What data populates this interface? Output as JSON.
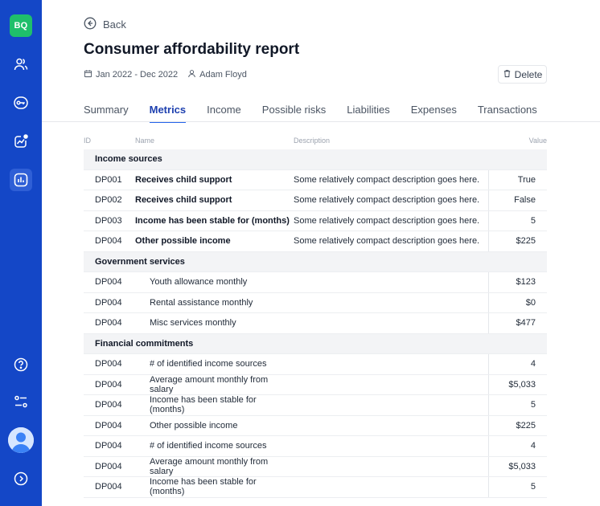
{
  "sidebar": {
    "logo": "BQ",
    "nav_icons": [
      "users-icon",
      "key-icon",
      "trend-icon",
      "chart-icon"
    ],
    "bottom_icons": [
      "help-icon",
      "settings-icon"
    ],
    "accent": "#1447c7",
    "logo_color": "#1fbf6b"
  },
  "header": {
    "back_label": "Back",
    "title": "Consumer affordability report",
    "date_range": "Jan 2022 - Dec 2022",
    "user": "Adam Floyd",
    "delete_label": "Delete"
  },
  "tabs": [
    {
      "label": "Summary",
      "active": false
    },
    {
      "label": "Metrics",
      "active": true
    },
    {
      "label": "Income",
      "active": false
    },
    {
      "label": "Possible risks",
      "active": false
    },
    {
      "label": "Liabilities",
      "active": false
    },
    {
      "label": "Expenses",
      "active": false
    },
    {
      "label": "Transactions",
      "active": false
    }
  ],
  "table": {
    "columns": {
      "id": "ID",
      "name": "Name",
      "description": "Description",
      "value": "Value"
    },
    "groups": [
      {
        "title": "Income sources",
        "rows": [
          {
            "id": "DP001",
            "name": "Receives child support",
            "description": "Some relatively compact description goes here.",
            "value": "True"
          },
          {
            "id": "DP002",
            "name": "Receives child support",
            "description": "Some relatively compact description goes here.",
            "value": "False"
          },
          {
            "id": "DP003",
            "name": "Income has been stable for (months)",
            "description": "Some relatively compact description goes here.",
            "value": "5"
          },
          {
            "id": "DP004",
            "name": "Other possible income",
            "description": "Some relatively compact description goes here.",
            "value": "$225"
          }
        ]
      },
      {
        "title": "Government services",
        "rows": [
          {
            "id": "DP004",
            "name": "Youth allowance monthly",
            "description": "",
            "value": "$123"
          },
          {
            "id": "DP004",
            "name": "Rental assistance monthly",
            "description": "",
            "value": "$0"
          },
          {
            "id": "DP004",
            "name": "Misc services monthly",
            "description": "",
            "value": "$477"
          }
        ]
      },
      {
        "title": "Financial commitments",
        "rows": [
          {
            "id": "DP004",
            "name": "# of identified income sources",
            "description": "",
            "value": "4"
          },
          {
            "id": "DP004",
            "name": "Average amount monthly from salary",
            "description": "",
            "value": "$5,033"
          },
          {
            "id": "DP004",
            "name": "Income has been stable for (months)",
            "description": "",
            "value": "5"
          },
          {
            "id": "DP004",
            "name": "Other possible income",
            "description": "",
            "value": "$225"
          },
          {
            "id": "DP004",
            "name": "# of identified income sources",
            "description": "",
            "value": "4"
          },
          {
            "id": "DP004",
            "name": "Average amount monthly from salary",
            "description": "",
            "value": "$5,033"
          },
          {
            "id": "DP004",
            "name": "Income has been stable for (months)",
            "description": "",
            "value": "5"
          }
        ]
      }
    ]
  }
}
